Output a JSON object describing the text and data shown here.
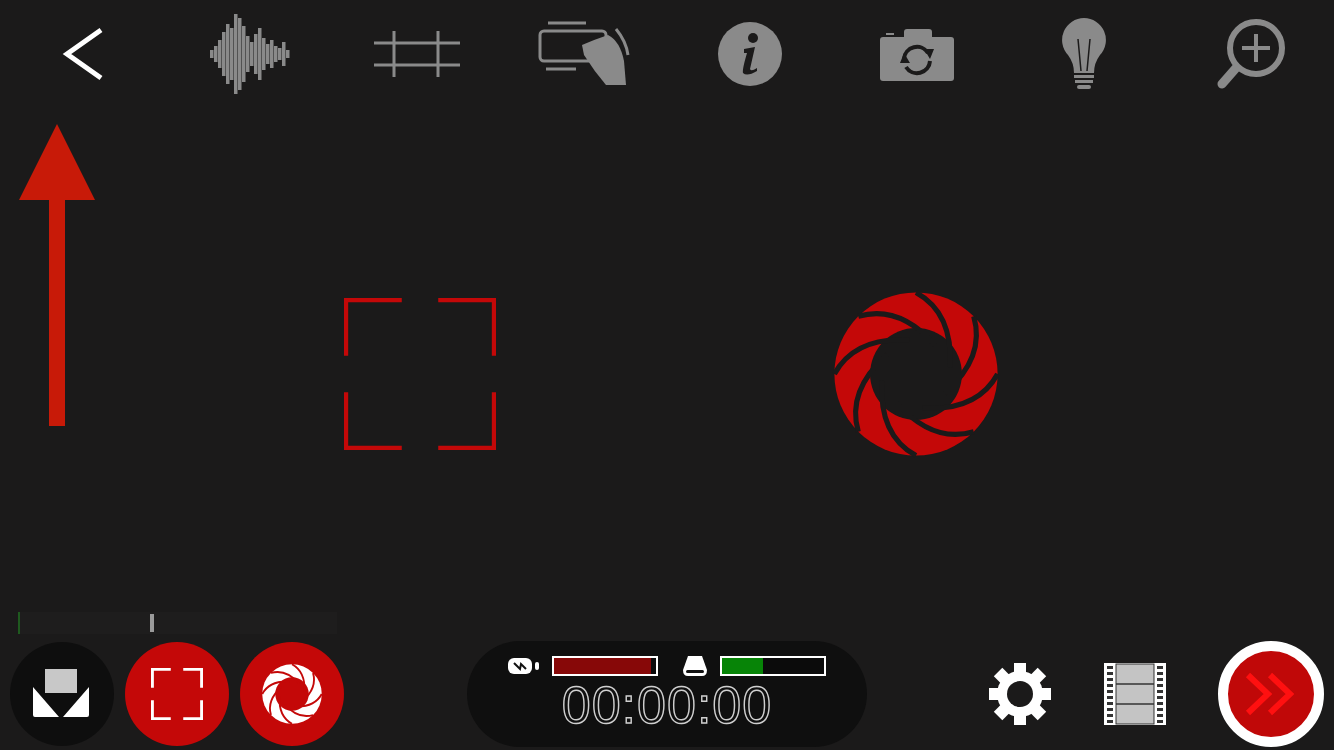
{
  "toolbar": [
    {
      "kind": "back"
    },
    {
      "kind": "waveform"
    },
    {
      "kind": "grid"
    },
    {
      "kind": "stabilize"
    },
    {
      "kind": "info"
    },
    {
      "kind": "flip-camera"
    },
    {
      "kind": "light"
    },
    {
      "kind": "zoom"
    }
  ],
  "audio_meter": {
    "level": 0.41
  },
  "mode_buttons": [
    {
      "kind": "overlay"
    },
    {
      "kind": "focus"
    },
    {
      "kind": "exposure"
    }
  ],
  "status": {
    "battery": {
      "level": 0.95
    },
    "storage": {
      "level": 0.4
    },
    "timecode": "00:00:00"
  },
  "right_buttons": [
    {
      "kind": "settings"
    },
    {
      "kind": "library"
    },
    {
      "kind": "record"
    }
  ]
}
